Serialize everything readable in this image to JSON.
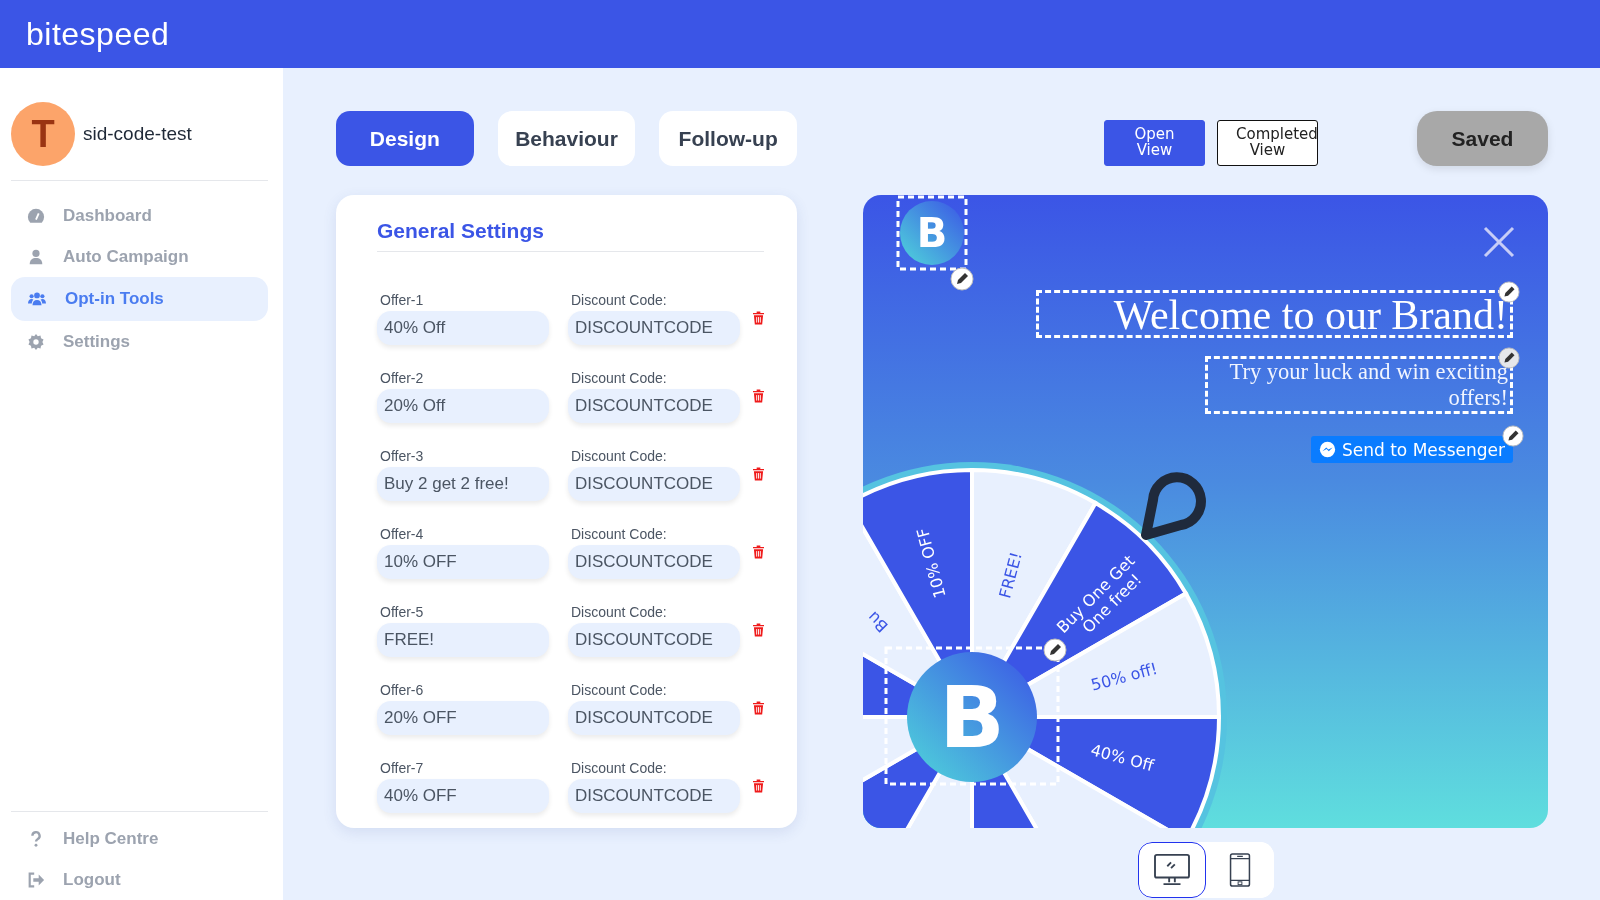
{
  "brand": {
    "logo": "bite**speed**"
  },
  "user": {
    "initial": "T",
    "name": "sid-code-test"
  },
  "nav": [
    {
      "label": "Dashboard",
      "kind": "dashboard",
      "selected": false
    },
    {
      "label": "Auto Campaign",
      "kind": "user",
      "selected": false
    },
    {
      "label": "Opt-in Tools",
      "kind": "users",
      "selected": true
    },
    {
      "label": "Settings",
      "kind": "gear",
      "selected": false
    }
  ],
  "footer_nav": [
    {
      "label": "Help Centre",
      "kind": "help"
    },
    {
      "label": "Logout",
      "kind": "logout"
    }
  ],
  "tabs": [
    {
      "label": "Design",
      "selected": true
    },
    {
      "label": "Behaviour",
      "selected": false
    },
    {
      "label": "Follow-up",
      "selected": false
    }
  ],
  "view_toggle": [
    {
      "label": "Open View",
      "selected": true
    },
    {
      "label": "Completed View",
      "selected": false
    }
  ],
  "save_button": "Saved",
  "settings": {
    "title": "General Settings",
    "offers": [
      {
        "label": "Offer-1",
        "value": "40% Off",
        "code_label": "Discount Code:",
        "code": "DISCOUNTCODE"
      },
      {
        "label": "Offer-2",
        "value": "20% Off",
        "code_label": "Discount Code:",
        "code": "DISCOUNTCODE"
      },
      {
        "label": "Offer-3",
        "value": "Buy 2 get 2 free!",
        "code_label": "Discount Code:",
        "code": "DISCOUNTCODE"
      },
      {
        "label": "Offer-4",
        "value": "10% OFF",
        "code_label": "Discount Code:",
        "code": "DISCOUNTCODE"
      },
      {
        "label": "Offer-5",
        "value": "FREE!",
        "code_label": "Discount Code:",
        "code": "DISCOUNTCODE"
      },
      {
        "label": "Offer-6",
        "value": "20% OFF",
        "code_label": "Discount Code:",
        "code": "DISCOUNTCODE"
      },
      {
        "label": "Offer-7",
        "value": "40% OFF",
        "code_label": "Discount Code:",
        "code": "DISCOUNTCODE"
      }
    ]
  },
  "preview": {
    "logo_letter": "B",
    "title": "Welcome to our Brand!",
    "subtitle": "Try your luck and win exciting offers!",
    "messenger_button": "Send to Messenger",
    "wheel": {
      "center_letter": "B",
      "segments": [
        {
          "color": "#e8f0fe",
          "lines": [
            "FREE!"
          ]
        },
        {
          "color": "#3b55e6",
          "lines": [
            "Buy One Get",
            "One free!"
          ]
        },
        {
          "color": "#e8f0fe",
          "lines": [
            "50% off!"
          ]
        },
        {
          "color": "#3b55e6",
          "lines": [
            "40% Off"
          ]
        },
        {
          "color": "#e8f0fe"
        },
        {
          "color": "#3b55e6"
        },
        {
          "color": "#e8f0fe"
        },
        {
          "color": "#3b55e6"
        },
        {
          "color": "#e8f0fe"
        },
        {
          "color": "#3b55e6"
        },
        {
          "color": "#e8f0fe",
          "lines": [
            "Bu"
          ]
        },
        {
          "color": "#3b55e6",
          "lines": [
            "10% OFF"
          ]
        }
      ]
    }
  },
  "devices": [
    {
      "kind": "desktop",
      "selected": true
    },
    {
      "kind": "mobile",
      "selected": false
    }
  ]
}
